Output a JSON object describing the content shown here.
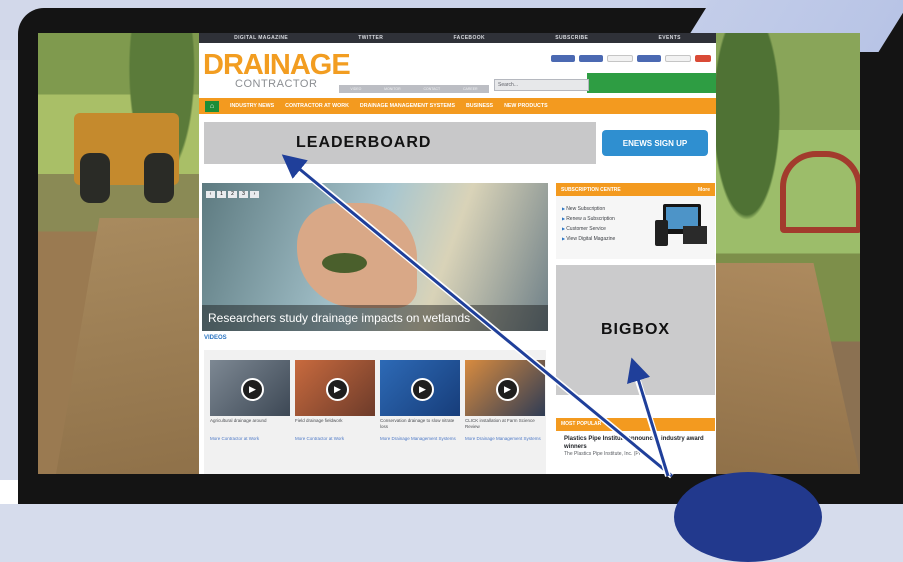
{
  "topnav": [
    "DIGITAL MAGAZINE",
    "TWITTER",
    "FACEBOOK",
    "SUBSCRIBE",
    "EVENTS"
  ],
  "logo": {
    "main": "DRAINAGE",
    "sub": "CONTRACTOR"
  },
  "search_placeholder": "Search...",
  "subnav": [
    "VIDEO",
    "MONITOR",
    "CONTACT",
    "CAREER"
  ],
  "mainnav": [
    "INDUSTRY NEWS",
    "CONTRACTOR AT WORK",
    "DRAINAGE MANAGEMENT SYSTEMS",
    "BUSINESS",
    "NEW PRODUCTS"
  ],
  "leaderboard": "LEADERBOARD",
  "enews": "ENEWS SIGN UP",
  "hero_caption": "Researchers study drainage impacts on wetlands",
  "videos_label": "VIDEOS",
  "videos": [
    {
      "caption": "Agricultural drainage around",
      "link": "More Contractor at Work"
    },
    {
      "caption": "Field drainage fieldwork",
      "link": "More Contractor at Work"
    },
    {
      "caption": "Conservation drainage to slow nitrate loss",
      "link": "More Drainage Management Systems"
    },
    {
      "caption": "CLICK installation at Farm Science Review",
      "link": "More Drainage Management Systems"
    }
  ],
  "subscription": {
    "title": "SUBSCRIPTION CENTRE",
    "more": "More",
    "items": [
      "New Subscription",
      "Renew a Subscription",
      "Customer Service",
      "View Digital Magazine"
    ]
  },
  "bigbox": "BIGBOX",
  "most_popular": {
    "title": "MOST POPULAR",
    "headline": "Plastics Pipe Institute announces industry award winners",
    "sub": "The Plastics Pipe Institute, Inc. (PPI)"
  },
  "colors": {
    "orange": "#f39a1f",
    "green": "#2e9d43",
    "blue": "#22398d"
  }
}
